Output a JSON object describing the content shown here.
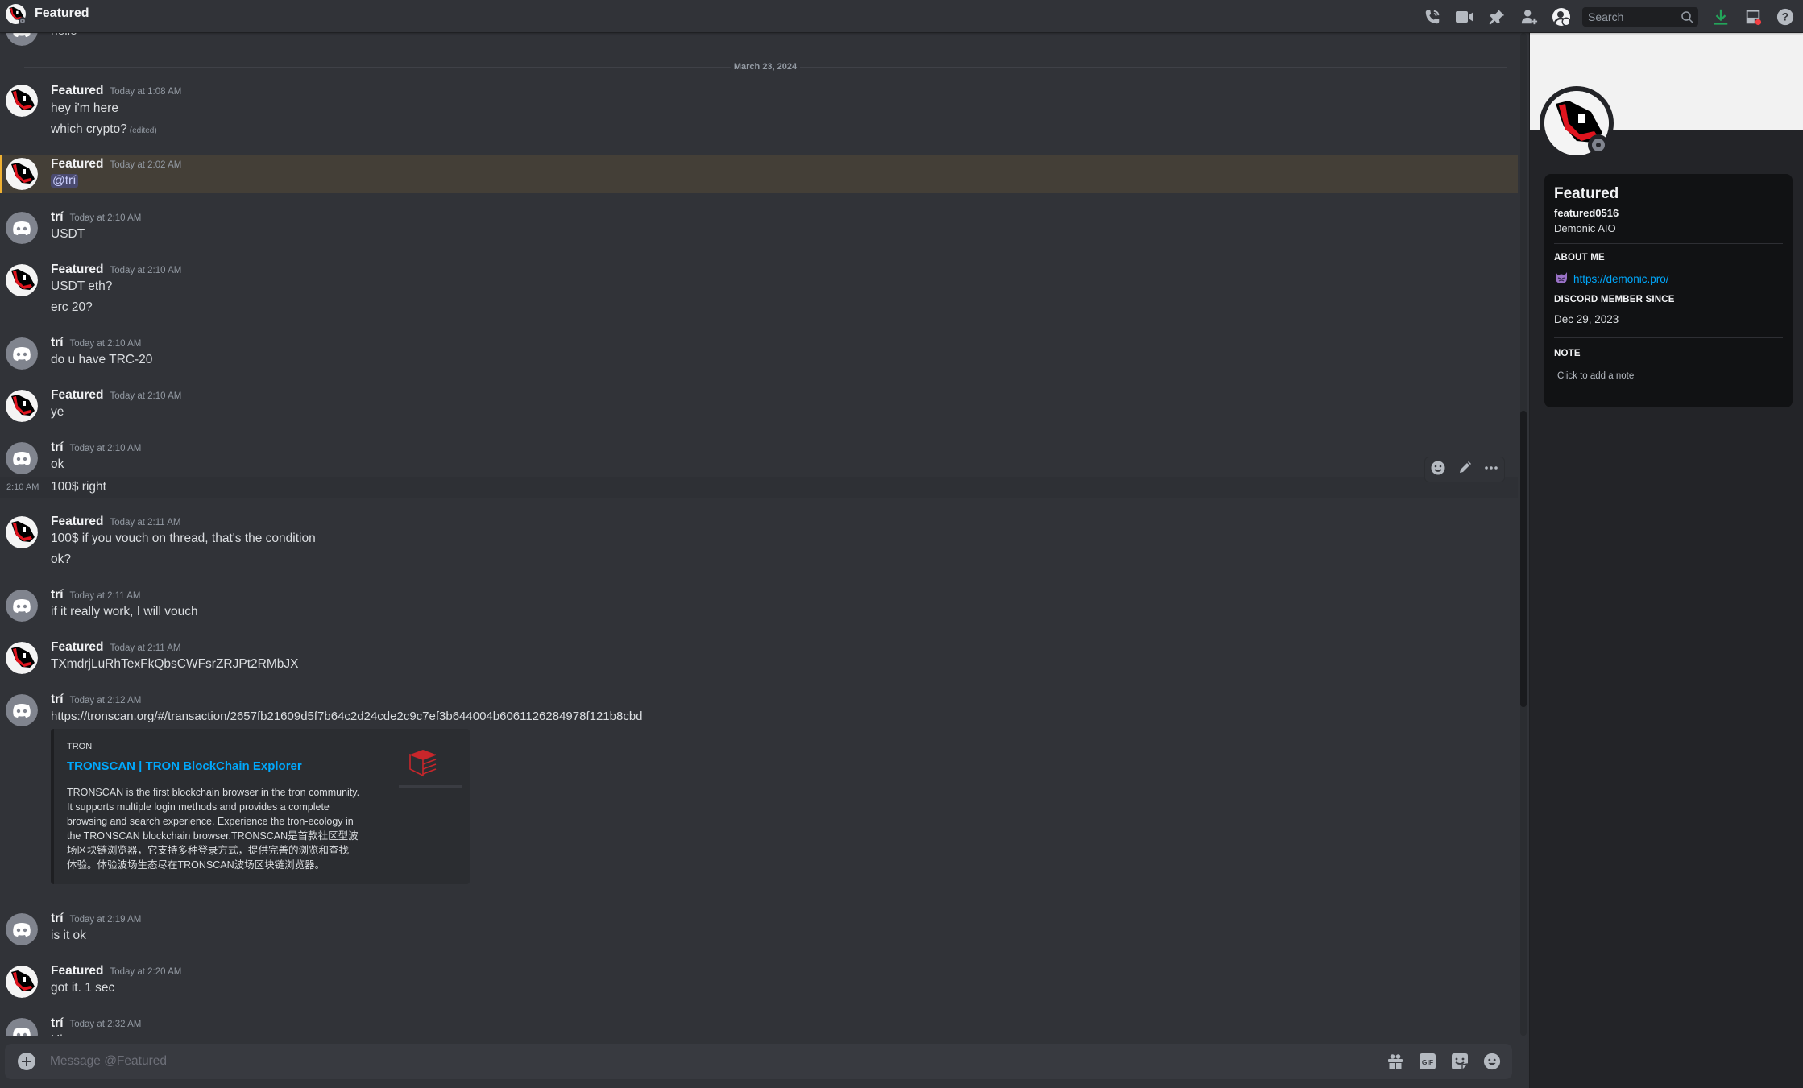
{
  "header": {
    "title": "Featured",
    "search_placeholder": "Search",
    "icons": [
      "start-voice-call-icon",
      "start-video-call-icon",
      "pinned-messages-icon",
      "add-friends-to-dm-icon",
      "user-profile-icon",
      "search-icon",
      "download-apps-icon",
      "inbox-icon",
      "help-icon"
    ]
  },
  "chat": {
    "top_partial_message": "hello",
    "date_divider": "March 23, 2024",
    "messages": [
      {
        "author": "Featured",
        "timestamp": "Today at 1:08 AM",
        "lines": [
          "hey i'm here",
          "which crypto?"
        ],
        "edited_label": "(edited)"
      },
      {
        "author": "Featured",
        "timestamp": "Today at 2:02 AM",
        "mention": "@trí",
        "highlighted": true
      },
      {
        "author": "trí",
        "timestamp": "Today at 2:10 AM",
        "lines": [
          "USDT"
        ]
      },
      {
        "author": "Featured",
        "timestamp": "Today at 2:10 AM",
        "lines": [
          "USDT eth?",
          "erc 20?"
        ]
      },
      {
        "author": "trí",
        "timestamp": "Today at 2:10 AM",
        "lines": [
          "do u have TRC-20"
        ]
      },
      {
        "author": "Featured",
        "timestamp": "Today at 2:10 AM",
        "lines": [
          "ye"
        ]
      },
      {
        "author": "trí",
        "timestamp": "Today at 2:10 AM",
        "lines": [
          "ok"
        ],
        "followup": {
          "side_timestamp": "2:10 AM",
          "text": "100$ right"
        }
      },
      {
        "author": "Featured",
        "timestamp": "Today at 2:11 AM",
        "lines": [
          "100$ if you vouch on thread, that's the condition",
          "ok?"
        ]
      },
      {
        "author": "trí",
        "timestamp": "Today at 2:11 AM",
        "lines": [
          "if it really work, I will vouch"
        ]
      },
      {
        "author": "Featured",
        "timestamp": "Today at 2:11 AM",
        "lines": [
          "TXmdrjLuRhTexFkQbsCWFsrZRJPt2RMbJX"
        ]
      },
      {
        "author": "trí",
        "timestamp": "Today at 2:12 AM",
        "link": "https://tronscan.org/#/transaction/2657fb21609d5f7b64c2d24cde2c9c7ef3b644004b6061126284978f121b8cbd"
      },
      {
        "author": "trí",
        "timestamp": "Today at 2:19 AM",
        "lines": [
          "is it ok"
        ]
      },
      {
        "author": "Featured",
        "timestamp": "Today at 2:20 AM",
        "lines": [
          "got it. 1 sec"
        ]
      },
      {
        "author": "trí",
        "timestamp": "Today at 2:32 AM",
        "lines": [
          "Hi"
        ]
      }
    ],
    "embed": {
      "provider": "TRON",
      "title": "TRONSCAN | TRON BlockChain Explorer",
      "description": "TRONSCAN is the first blockchain browser in the tron community.\nIt supports multiple login methods and provides a complete\nbrowsing and search experience. Experience the tron-ecology in\nthe TRONSCAN blockchain browser.TRONSCAN是首款社区型波\n场区块链浏览器，它支持多种登录方式，提供完善的浏览和查找\n体验。体验波场生态尽在TRONSCAN波场区块链浏览器。"
    },
    "hover_actions": [
      "add-reaction-icon",
      "edit-icon",
      "more-icon"
    ]
  },
  "composer": {
    "placeholder": "Message @Featured",
    "icons": [
      "gift-icon",
      "gif-icon",
      "sticker-icon",
      "emoji-icon"
    ],
    "gif_label": "GIF"
  },
  "profile": {
    "display_name": "Featured",
    "username": "featured0516",
    "pronouns": "Demonic AIO",
    "about_me_label": "ABOUT ME",
    "about_me_emoji": "😈",
    "about_me_link": "https://demonic.pro/",
    "member_since_label": "DISCORD MEMBER SINCE",
    "member_since": "Dec 29, 2023",
    "note_label": "NOTE",
    "note_placeholder": "Click to add a note"
  },
  "colors": {
    "accent_link": "#00a8fc",
    "mention_bg": "#4a4f7a",
    "mention_highlight": "#f0b132",
    "download_green": "#23a55a",
    "inbox_dot": "#f23f43"
  }
}
